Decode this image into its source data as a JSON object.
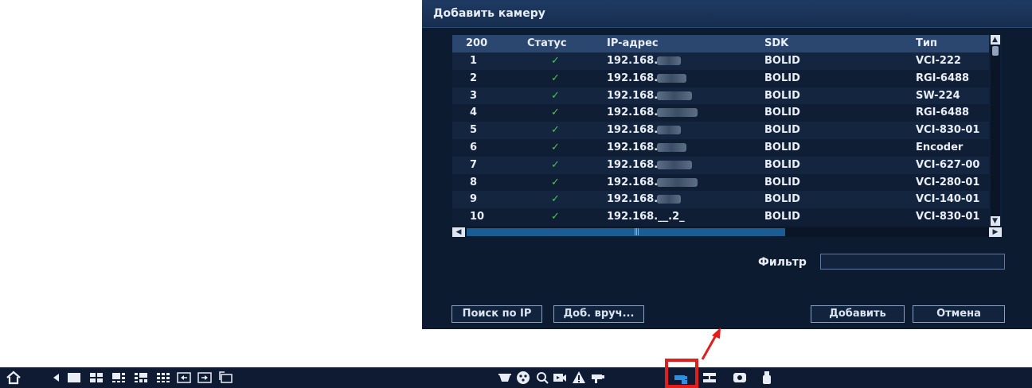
{
  "dialog": {
    "title": "Добавить камеру",
    "columns": {
      "count": "200",
      "status": "Статус",
      "ip": "IP-адрес",
      "sdk": "SDK",
      "type": "Тип"
    },
    "rows": [
      {
        "num": "1",
        "status": "✓",
        "ip": "192.168.",
        "sdk": "BOLID",
        "type": "VCI-222"
      },
      {
        "num": "2",
        "status": "✓",
        "ip": "192.168.",
        "sdk": "BOLID",
        "type": "RGI-6488"
      },
      {
        "num": "3",
        "status": "✓",
        "ip": "192.168.",
        "sdk": "BOLID",
        "type": "SW-224"
      },
      {
        "num": "4",
        "status": "✓",
        "ip": "192.168.",
        "sdk": "BOLID",
        "type": "RGI-6488"
      },
      {
        "num": "5",
        "status": "✓",
        "ip": "192.168.",
        "sdk": "BOLID",
        "type": "VCI-830-01"
      },
      {
        "num": "6",
        "status": "✓",
        "ip": "192.168.",
        "sdk": "BOLID",
        "type": "Encoder"
      },
      {
        "num": "7",
        "status": "✓",
        "ip": "192.168.",
        "sdk": "BOLID",
        "type": "VCI-627-00"
      },
      {
        "num": "8",
        "status": "✓",
        "ip": "192.168.",
        "sdk": "BOLID",
        "type": "VCI-280-01"
      },
      {
        "num": "9",
        "status": "✓",
        "ip": "192.168.",
        "sdk": "BOLID",
        "type": "VCI-140-01"
      },
      {
        "num": "10",
        "status": "✓",
        "ip": "192.168.__.2_",
        "sdk": "BOLID",
        "type": "VCI-830-01"
      }
    ],
    "filter_label": "Фильтр",
    "filter_value": "",
    "buttons": {
      "search_ip": "Поиск по IP",
      "manual_add": "Доб. вруч...",
      "add": "Добавить",
      "cancel": "Отмена"
    }
  },
  "taskbar": {
    "left_icons": [
      "home-icon",
      "back-icon",
      "layout-1-icon",
      "layout-4-icon",
      "layout-6-icon",
      "layout-8-icon",
      "layout-9-icon",
      "layout-prev-icon",
      "layout-next-icon",
      "layout-custom-icon"
    ],
    "right_icons": [
      "ptz-icon",
      "color-icon",
      "search-icon",
      "playback-icon",
      "alarm-icon",
      "camera-icon",
      "ip-camera-icon",
      "network-icon",
      "hdd-icon",
      "usb-icon"
    ],
    "highlighted_icon": "ip-camera-icon"
  },
  "colors": {
    "accent": "#1b5d92",
    "check": "#4fc25a",
    "highlight": "#e31c1c"
  }
}
